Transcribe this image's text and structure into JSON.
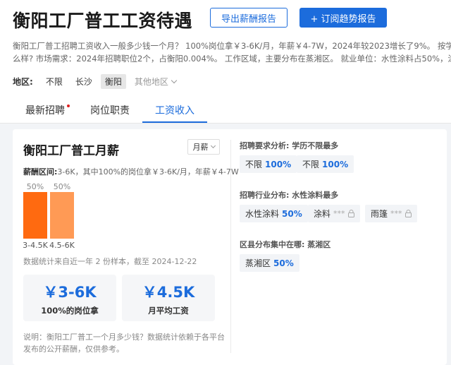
{
  "header": {
    "title": "衡阳工厂普工工资待遇",
    "export_label": "导出薪酬报告",
    "subscribe_label": "+ 订阅趋势报告"
  },
  "description": {
    "line1": "衡阳工厂普工招聘工资收入一般多少钱一个月？ 100%岗位拿￥3-6K/月，年薪￥4-7W，2024年较2023增长了9%。 按学历",
    "line2": "么样? 市场需求：2024年招聘职位2个，占衡阳0.004%。 工作区域，主要分布在蒸湘区。 就业单位：水性涂料占50%，涂"
  },
  "region": {
    "label": "地区:",
    "options": [
      "不限",
      "长沙",
      "衡阳"
    ],
    "active": "衡阳",
    "more_label": "其他地区"
  },
  "tabs": [
    {
      "label": "最新招聘",
      "dot": true
    },
    {
      "label": "岗位职责",
      "dot": false
    },
    {
      "label": "工资收入",
      "dot": false
    }
  ],
  "monthly": {
    "title": "衡阳工厂普工月薪",
    "period": "月薪",
    "range_label": "薪酬区间:",
    "range_text": "3-6K，其中100%的岗位拿￥3-6K/月，年薪￥4-7W",
    "sample_note": "数据统计来自近一年 2 份样本，截至 2024-12-22",
    "stats": [
      {
        "value": "￥3-6K",
        "label": "100%的岗位拿"
      },
      {
        "value": "￥4.5K",
        "label": "月平均工资"
      }
    ],
    "explain": "说明：衡阳工厂普工一个月多少钱？数据统计依赖于各平台发布的公开薪酬，仅供参考。"
  },
  "chart_data": {
    "type": "bar",
    "categories": [
      "3-4.5K",
      "4.5-6K"
    ],
    "values": [
      50,
      50
    ],
    "labels": [
      "50%",
      "50%"
    ],
    "colors": [
      "#ff6a10",
      "#ff9a55"
    ],
    "ylim": [
      0,
      50
    ]
  },
  "requirements": {
    "title": "招聘要求分析: 学历不限最多",
    "chips": [
      {
        "label": "不限",
        "pct": "100%"
      },
      {
        "label": "不限",
        "pct": "100%"
      }
    ]
  },
  "industry": {
    "title": "招聘行业分布: 水性涂料最多",
    "chips": [
      {
        "label": "水性涂料",
        "pct": "50%",
        "locked": false
      },
      {
        "label": "涂料",
        "mask": "***",
        "locked": true
      },
      {
        "label": "雨篷",
        "mask": "***",
        "locked": true
      }
    ]
  },
  "district": {
    "title": "区县分布集中在哪: 蒸湘区",
    "chips": [
      {
        "label": "蒸湘区",
        "pct": "50%"
      }
    ]
  },
  "colors": {
    "accent": "#1c6cdc",
    "bar_primary": "#ff6a10",
    "bar_secondary": "#ff9a55"
  }
}
